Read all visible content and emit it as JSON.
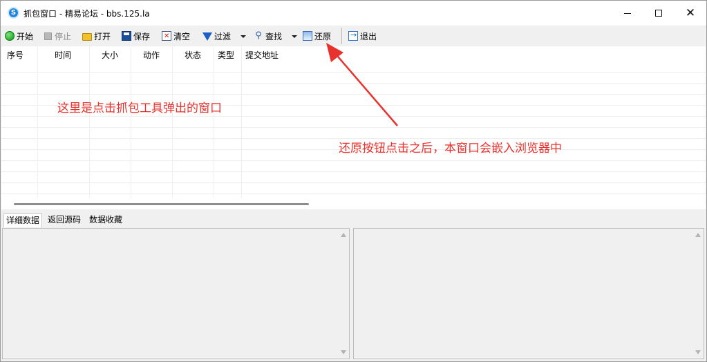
{
  "window": {
    "title": "抓包窗口 - 精易论坛 - bbs.125.la",
    "app_icon_glyph": "S"
  },
  "toolbar": {
    "start_label": "开始",
    "stop_label": "停止",
    "open_label": "打开",
    "save_label": "保存",
    "clear_label": "清空",
    "filter_label": "过滤",
    "find_label": "查找",
    "restore_label": "还原",
    "exit_label": "退出"
  },
  "packet_list": {
    "columns": [
      "序号",
      "时间",
      "大小",
      "动作",
      "状态",
      "类型",
      "提交地址"
    ]
  },
  "tabs": [
    "详细数据",
    "返回源码",
    "数据收藏"
  ],
  "annotations": {
    "note_1": "这里是点击抓包工具弹出的窗口",
    "note_2": "还原按钮点击之后，本窗口会嵌入浏览器中"
  },
  "colors": {
    "annotation": "#e8322e",
    "start_icon": "#0a9a10",
    "titlebar_bg": "#ffffff",
    "toolbar_bg": "#f0f0f0"
  }
}
